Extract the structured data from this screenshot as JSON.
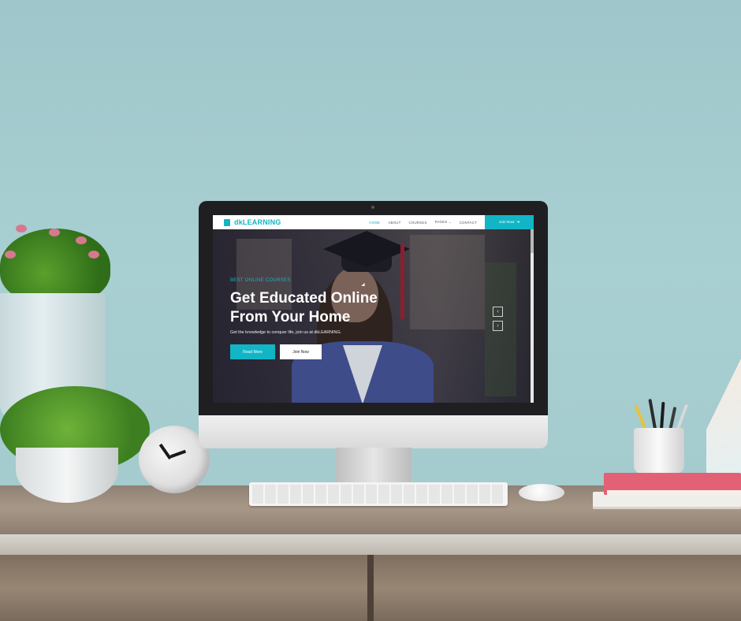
{
  "site": {
    "brand": "dkLEARNING",
    "nav": [
      "HOME",
      "ABOUT",
      "COURSES",
      "PAGES",
      "CONTACT"
    ],
    "nav_pages_chevron": "⌄",
    "join_nav": "Join Now",
    "join_nav_arrow": "➜",
    "hero": {
      "eyebrow": "BEST ONLINE COURSES",
      "headline": "Get Educated Online From Your Home",
      "sub": "Get the knowledge to conquer life, join us at dkLEARNING.",
      "read_more": "Read More",
      "join_now": "Join Now"
    },
    "carousel": {
      "prev": "‹",
      "next": "›"
    },
    "colors": {
      "accent": "#12b5c6"
    }
  }
}
